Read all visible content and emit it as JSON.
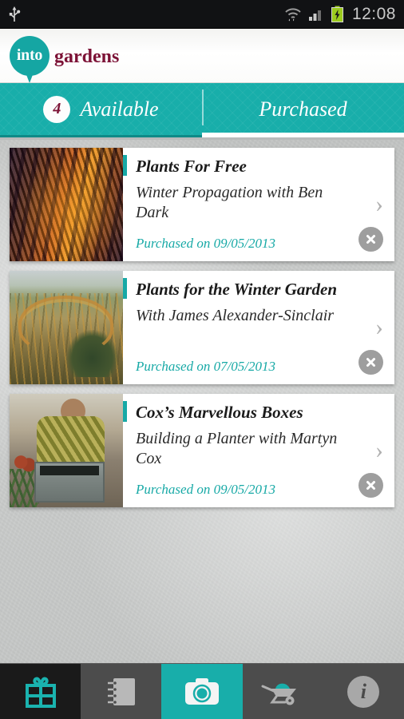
{
  "statusbar": {
    "time": "12:08",
    "icons": [
      "usb-icon",
      "wifi-icon",
      "signal-icon",
      "battery-charging-icon"
    ]
  },
  "header": {
    "logo_primary": "into",
    "logo_secondary": "gardens",
    "brand_teal": "#18aeaa",
    "brand_maroon": "#7c1236"
  },
  "tabs": [
    {
      "label": "Available",
      "badge": "4",
      "active": false
    },
    {
      "label": "Purchased",
      "badge": null,
      "active": true
    }
  ],
  "cards": [
    {
      "title": "Plants For Free",
      "subtitle": "Winter Propagation with Ben Dark",
      "meta": "Purchased on 09/05/2013",
      "thumb": "fern-frond-thumbnail",
      "chevron": "›",
      "delete": "✕"
    },
    {
      "title": "Plants for the Winter Garden",
      "subtitle": "With James Alexander-Sinclair",
      "meta": "Purchased on 07/05/2013",
      "thumb": "winter-garden-thumbnail",
      "chevron": "›",
      "delete": "✕"
    },
    {
      "title": "Cox’s Marvellous Boxes",
      "subtitle": "Building a Planter with Martyn Cox",
      "meta": "Purchased on 09/05/2013",
      "thumb": "planter-build-thumbnail",
      "chevron": "›",
      "delete": "✕"
    }
  ],
  "navbar": {
    "items": [
      {
        "name": "gift",
        "state": "dark"
      },
      {
        "name": "notebook",
        "state": "normal"
      },
      {
        "name": "camera",
        "state": "teal"
      },
      {
        "name": "wheelbarrow",
        "state": "normal"
      },
      {
        "name": "info",
        "state": "normal",
        "glyph": "i"
      }
    ]
  }
}
